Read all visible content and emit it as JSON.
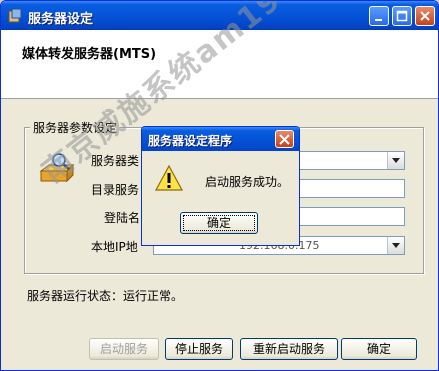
{
  "window": {
    "title": "服务器设定",
    "icon": "app-icon"
  },
  "header": {
    "title": "媒体转发服务器(MTS)"
  },
  "group": {
    "legend": "服务器参数设定",
    "icon": "server-icon",
    "fields": {
      "server_type_label": "服务器类",
      "dir_server_label": "目录服务",
      "login_label": "登陆名",
      "local_ip_label": "本地IP地",
      "local_ip_value": "192.168.0.175"
    }
  },
  "status_text": "服务器运行状态：运行正常。",
  "buttons": {
    "start": "启动服务",
    "stop": "停止服务",
    "restart": "重新启动服务",
    "ok": "确定"
  },
  "dialog": {
    "title": "服务器设定程序",
    "message": "启动服务成功。",
    "ok": "确定",
    "icon": "warning-icon"
  },
  "watermark": "南京威施系统am1918.com",
  "colors": {
    "titlebar": "#0553d8",
    "window_bg": "#ece9d8",
    "close_red": "#c5421b"
  }
}
